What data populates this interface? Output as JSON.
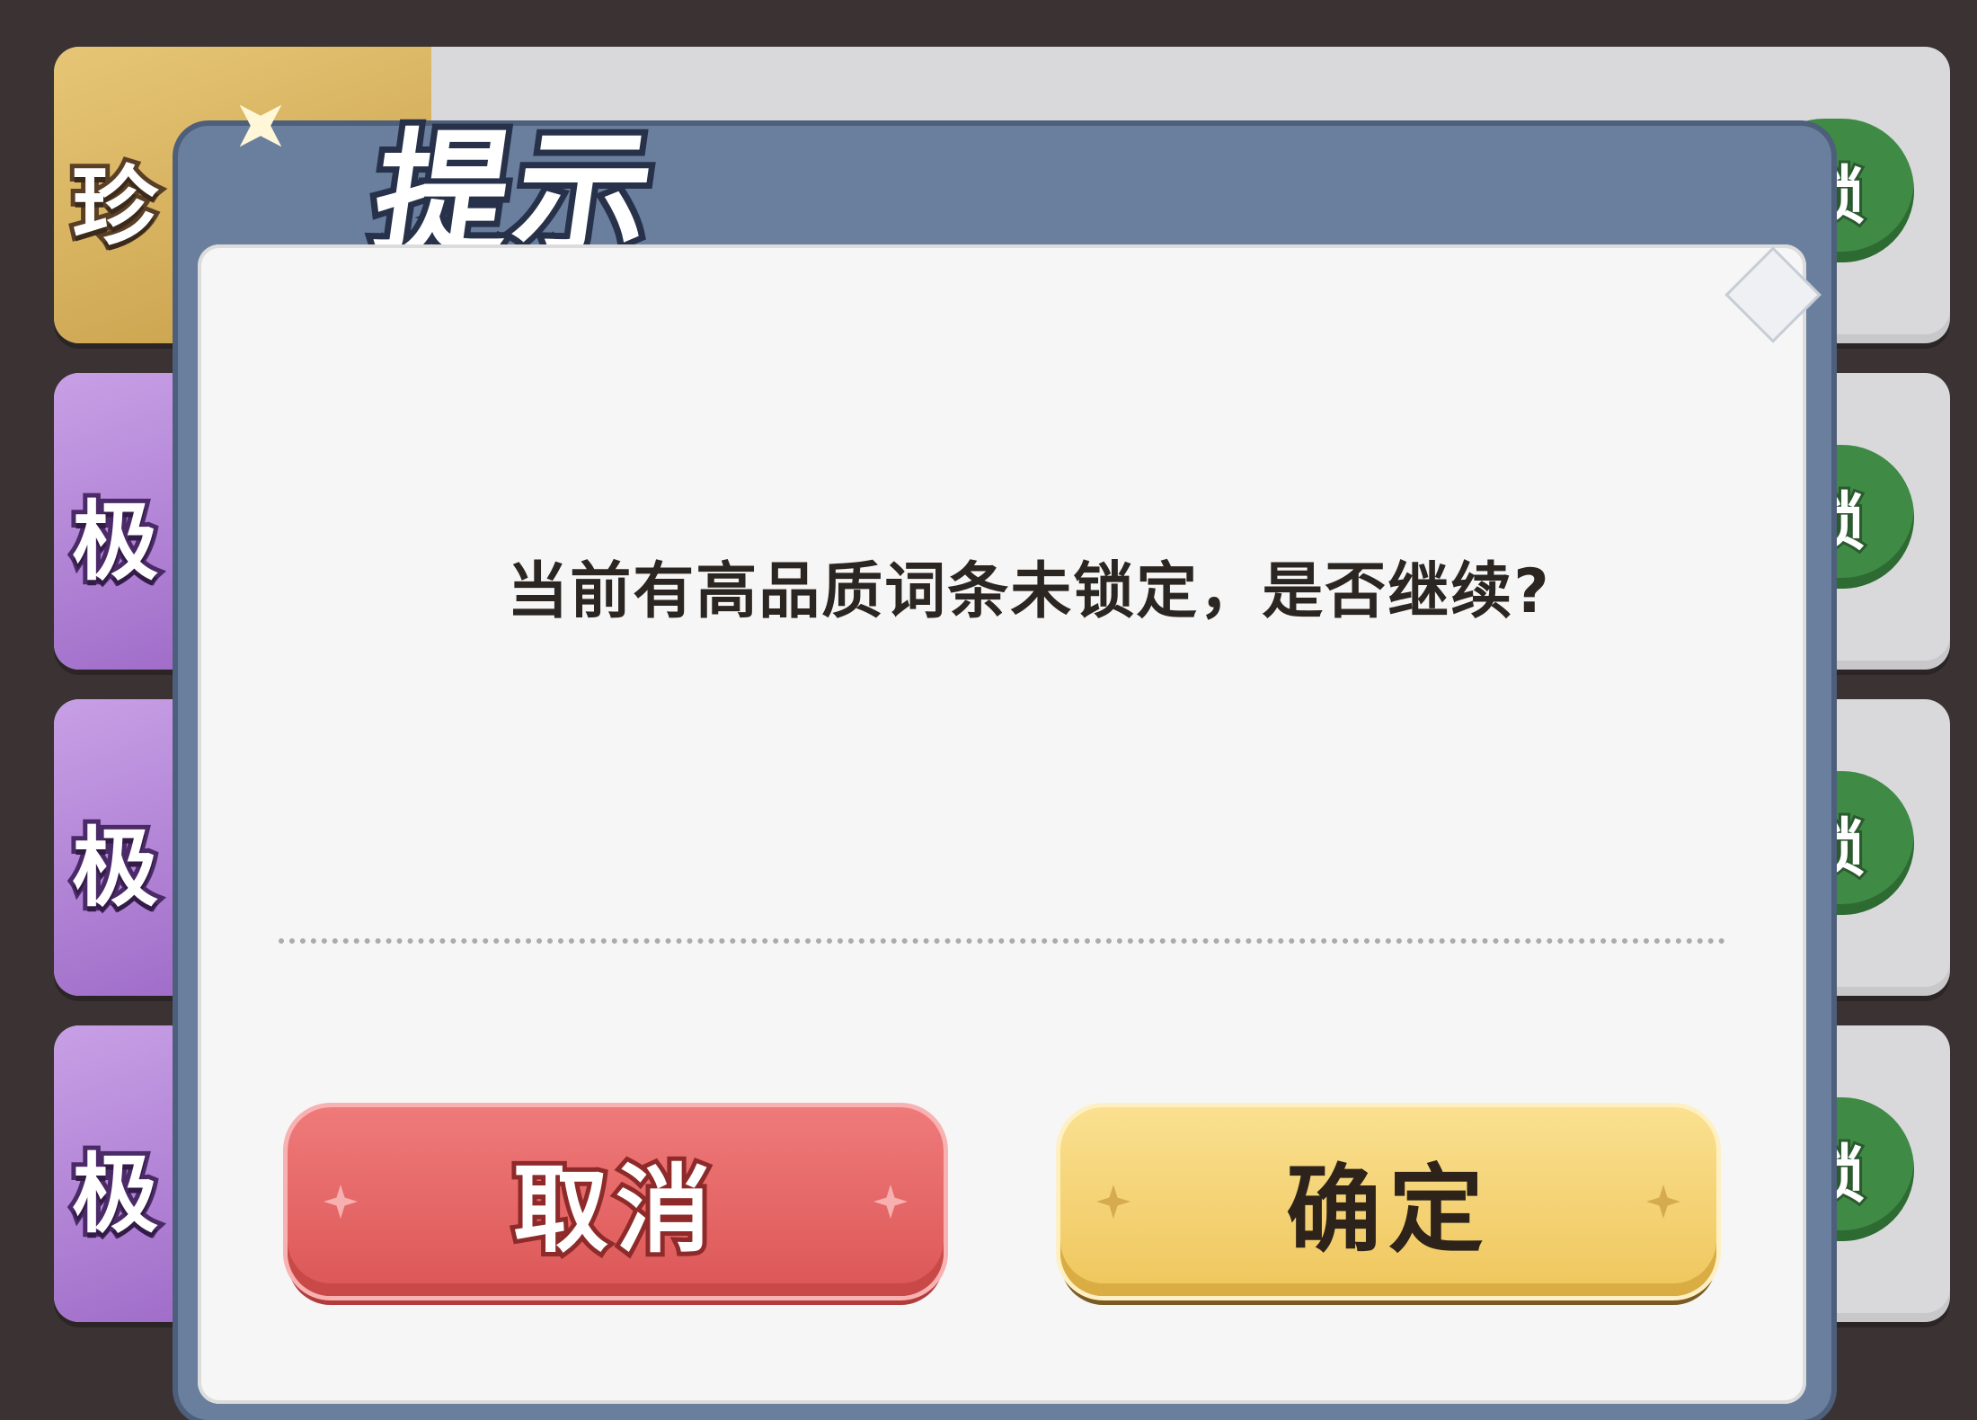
{
  "background": {
    "rows": [
      {
        "tag_label": "珍",
        "tag_style": "gold",
        "lock_label": "锁"
      },
      {
        "tag_label": "极",
        "tag_style": "purple",
        "lock_label": "锁"
      },
      {
        "tag_label": "极",
        "tag_style": "purple",
        "lock_label": "锁"
      },
      {
        "tag_label": "极",
        "tag_style": "purple",
        "lock_label": "锁"
      }
    ]
  },
  "dialog": {
    "title": "提示",
    "message": "当前有高品质词条未锁定，是否继续?",
    "cancel_label": "取消",
    "confirm_label": "确定"
  },
  "colors": {
    "frame": "#6a7f9e",
    "panel": "#f6f6f6",
    "cancel": "#e26060",
    "confirm": "#f3cf72",
    "lock": "#3f8a45"
  }
}
